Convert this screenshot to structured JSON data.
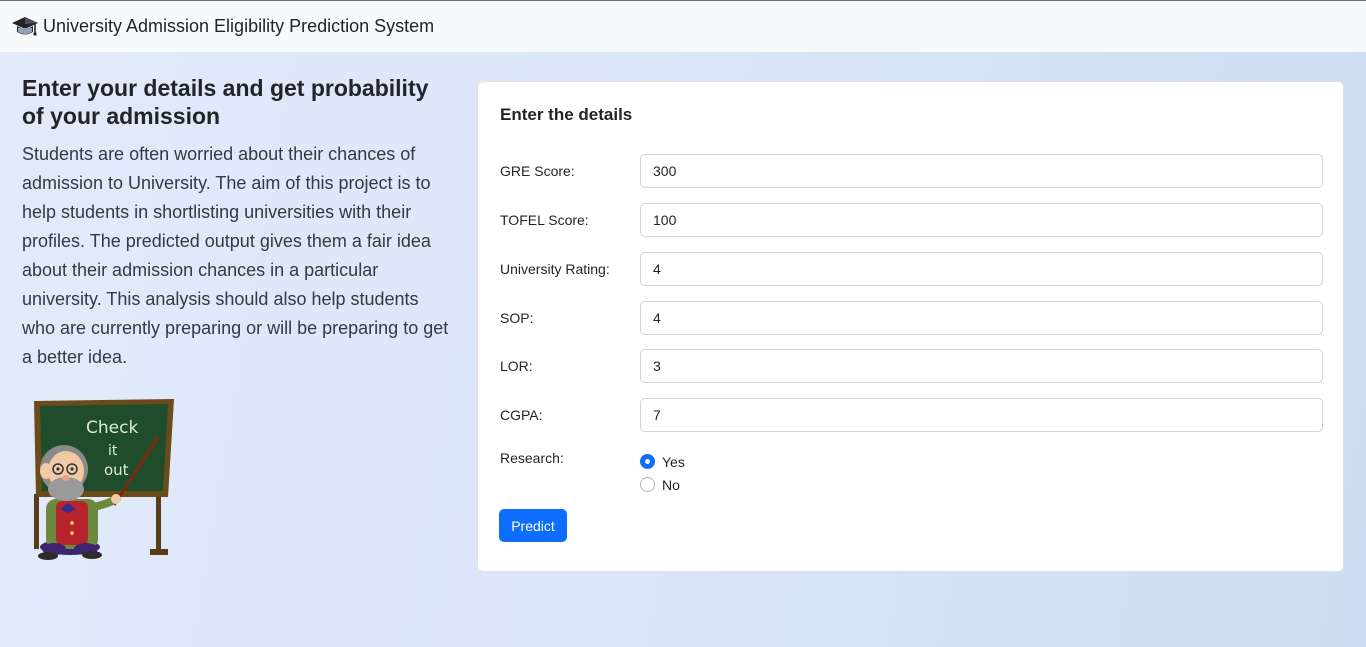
{
  "navbar": {
    "brand_icon": "graduation-cap-icon",
    "title": "University Admission Eligibility Prediction System"
  },
  "intro": {
    "headline": "Enter your details and get probability of your admission",
    "description": "Students are often worried about their chances of admission to University. The aim of this project is to help students in shortlisting universities with their profiles. The predicted output gives them a fair idea about their admission chances in a particular university. This analysis should also help students who are currently preparing or will be preparing to get a better idea.",
    "image_text": "Check it out"
  },
  "form": {
    "title": "Enter the details",
    "fields": {
      "gre": {
        "label": "GRE Score:",
        "value": "300"
      },
      "tofel": {
        "label": "TOFEL Score:",
        "value": "100"
      },
      "university_rating": {
        "label": "University Rating:",
        "value": "4"
      },
      "sop": {
        "label": "SOP:",
        "value": "4"
      },
      "lor": {
        "label": "LOR:",
        "value": "3"
      },
      "cgpa": {
        "label": "CGPA:",
        "value": "7"
      }
    },
    "research": {
      "label": "Research:",
      "options": [
        "Yes",
        "No"
      ],
      "selected": "Yes"
    },
    "predict_label": "Predict"
  },
  "colors": {
    "primary": "#0d6efd",
    "navbar_bg": "#f8f9fa",
    "page_bg": "#dde7f8"
  }
}
